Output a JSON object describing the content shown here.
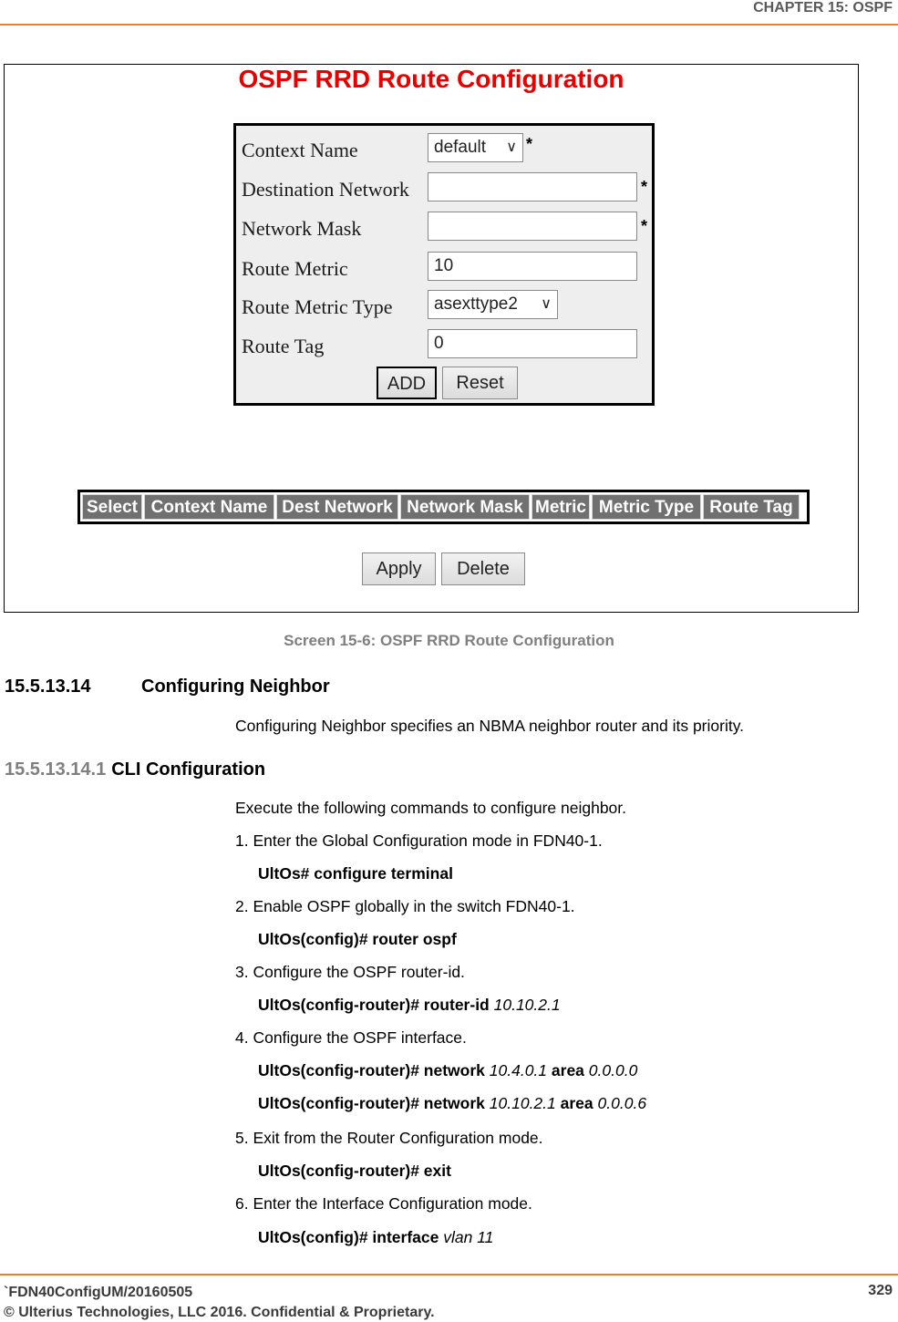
{
  "header": {
    "chapter": "CHAPTER 15: OSPF"
  },
  "screen": {
    "title": "OSPF RRD Route Configuration",
    "form": {
      "context_name": {
        "label": "Context Name",
        "value": "default",
        "required": "*"
      },
      "destination_network": {
        "label": "Destination Network",
        "value": "",
        "required": "*"
      },
      "network_mask": {
        "label": "Network Mask",
        "value": "",
        "required": "*"
      },
      "route_metric": {
        "label": "Route Metric",
        "value": "10"
      },
      "route_metric_type": {
        "label": "Route Metric Type",
        "value": "asexttype2"
      },
      "route_tag": {
        "label": "Route Tag",
        "value": "0"
      },
      "add_label": "ADD",
      "reset_label": "Reset"
    },
    "table": {
      "columns": [
        "Select",
        "Context Name",
        "Dest Network",
        "Network Mask",
        "Metric",
        "Metric Type",
        "Route Tag"
      ]
    },
    "apply_label": "Apply",
    "delete_label": "Delete"
  },
  "caption": "Screen 15-6: OSPF RRD Route Configuration",
  "section": {
    "number": "15.5.13.14",
    "title": "Configuring Neighbor",
    "intro": "Configuring Neighbor specifies an NBMA neighbor router and its priority."
  },
  "subsection": {
    "number": "15.5.13.14.1",
    "title": "CLI Configuration",
    "intro": "Execute the following commands to configure neighbor.",
    "steps": [
      {
        "text": "1. Enter the Global Configuration mode in FDN40-1.",
        "commands": [
          {
            "bold": "UltOs# configure terminal"
          }
        ]
      },
      {
        "text": "2. Enable OSPF globally in the switch FDN40-1.",
        "commands": [
          {
            "bold": "UltOs(config)# router ospf"
          }
        ]
      },
      {
        "text": "3. Configure the OSPF router-id.",
        "commands": [
          {
            "bold": "UltOs(config-router)# router-id",
            "arg": "10.10.2.1"
          }
        ]
      },
      {
        "text": "4. Configure the OSPF interface.",
        "commands": [
          {
            "bold": "UltOs(config-router)# network",
            "arg": "10.4.0.1",
            "bold2": "area",
            "arg2": "0.0.0.0"
          },
          {
            "bold": "UltOs(config-router)# network",
            "arg": "10.10.2.1",
            "bold2": "area",
            "arg2": "0.0.0.6"
          }
        ]
      },
      {
        "text": "5. Exit from the Router Configuration mode.",
        "commands": [
          {
            "bold": "UltOs(config-router)# exit"
          }
        ]
      },
      {
        "text": "6. Enter the Interface Configuration mode.",
        "commands": [
          {
            "bold": "UltOs(config)# interface",
            "arg": "vlan 11"
          }
        ]
      }
    ]
  },
  "footer": {
    "doc_id": "`FDN40ConfigUM/20160505",
    "copyright": "© Ulterius Technologies, LLC 2016. Confidential & Proprietary.",
    "page_number": "329"
  }
}
